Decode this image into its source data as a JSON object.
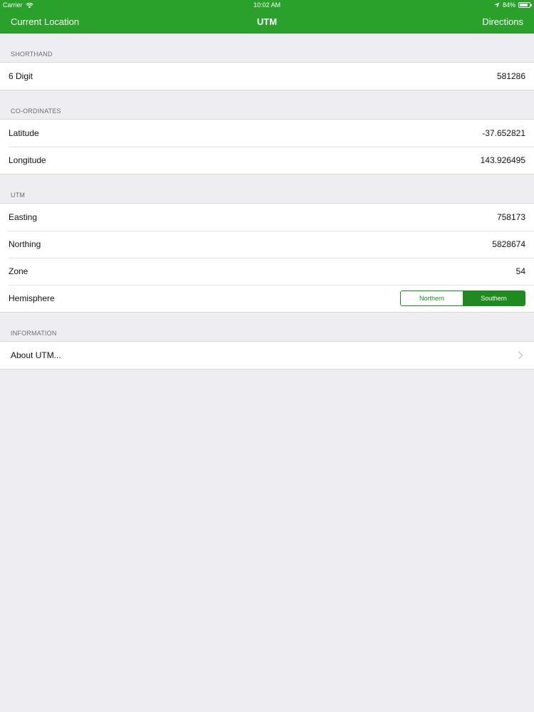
{
  "status": {
    "carrier": "Carrier",
    "time": "10:02 AM",
    "battery": "84%",
    "battery_level": 0.84
  },
  "nav": {
    "left": "Current Location",
    "title": "UTM",
    "right": "Directions"
  },
  "sections": {
    "shorthand": {
      "header": "SHORTHAND",
      "six_digit_label": "6 Digit",
      "six_digit_value": "581286"
    },
    "coordinates": {
      "header": "CO-ORDINATES",
      "latitude_label": "Latitude",
      "latitude_value": "-37.652821",
      "longitude_label": "Longitude",
      "longitude_value": "143.926495"
    },
    "utm": {
      "header": "UTM",
      "easting_label": "Easting",
      "easting_value": "758173",
      "northing_label": "Northing",
      "northing_value": "5828674",
      "zone_label": "Zone",
      "zone_value": "54",
      "hemisphere_label": "Hemisphere",
      "hemisphere_options": [
        "Northern",
        "Southern"
      ],
      "hemisphere_selected": "Southern"
    },
    "information": {
      "header": "INFORMATION",
      "about_label": "About UTM..."
    }
  },
  "colors": {
    "bar_green": "#2aa12a",
    "accent_green": "#1f8a1f",
    "background": "#eeedf2"
  }
}
